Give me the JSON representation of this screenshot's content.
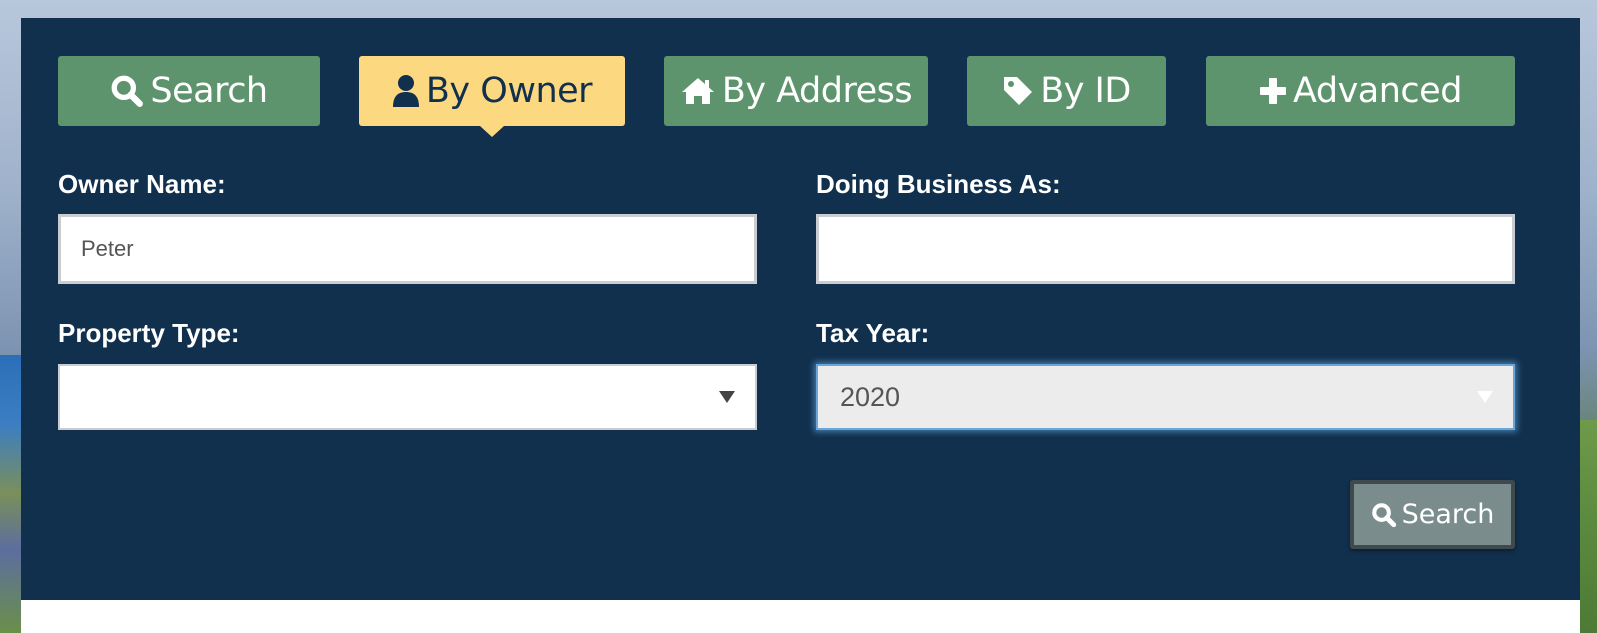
{
  "tabs": [
    {
      "label": "Search",
      "icon": "search-icon",
      "active": false
    },
    {
      "label": "By Owner",
      "icon": "user-icon",
      "active": true
    },
    {
      "label": "By Address",
      "icon": "home-icon",
      "active": false
    },
    {
      "label": "By ID",
      "icon": "tag-icon",
      "active": false
    },
    {
      "label": "Advanced",
      "icon": "plus-icon",
      "active": false
    }
  ],
  "form": {
    "owner_name": {
      "label": "Owner Name:",
      "value": "Peter"
    },
    "doing_business_as": {
      "label": "Doing Business As:",
      "value": ""
    },
    "property_type": {
      "label": "Property Type:",
      "value": ""
    },
    "tax_year": {
      "label": "Tax Year:",
      "value": "2020"
    },
    "submit_label": "Search"
  },
  "colors": {
    "panel": "#11304d",
    "tab": "#5e946d",
    "tab_active": "#fcd981",
    "submit": "#7a8d8c"
  }
}
